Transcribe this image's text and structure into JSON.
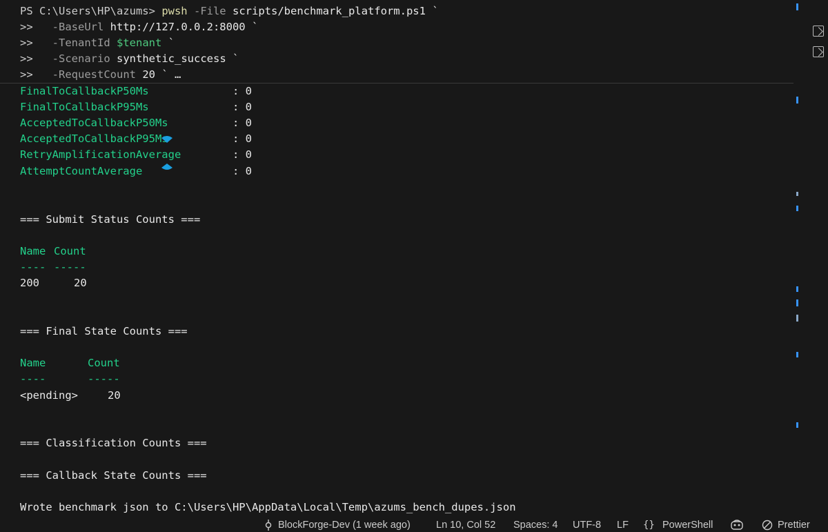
{
  "command": {
    "prompt": "PS C:\\Users\\HP\\azums>",
    "exe": "pwsh",
    "file_flag": "-File",
    "file_value": "scripts/benchmark_platform.ps1",
    "tick": "`",
    "continuation": ">>",
    "base_url_flag": "-BaseUrl",
    "base_url_value": "http://127.0.0.2:8000",
    "tenant_flag": "-TenantId",
    "tenant_value": "$tenant",
    "scenario_flag": "-Scenario",
    "scenario_value": "synthetic_success",
    "request_flag": "-RequestCount",
    "request_value": "20",
    "truncation": "` …"
  },
  "metrics": [
    {
      "name": "FinalToCallbackP50Ms",
      "value": ": 0"
    },
    {
      "name": "FinalToCallbackP95Ms",
      "value": ": 0"
    },
    {
      "name": "AcceptedToCallbackP50Ms",
      "value": ": 0"
    },
    {
      "name": "AcceptedToCallbackP95Ms",
      "value": ": 0"
    },
    {
      "name": "RetryAmplificationAverage",
      "value": ": 0"
    },
    {
      "name": "AttemptCountAverage",
      "value": ": 0"
    }
  ],
  "submit_status": {
    "heading": "=== Submit Status Counts ===",
    "col_name": "Name",
    "col_count": "Count",
    "rule_name": "----",
    "rule_count": "-----",
    "rows": [
      {
        "name": "200",
        "count": "20"
      }
    ]
  },
  "final_state": {
    "heading": "=== Final State Counts ===",
    "col_name": "Name",
    "col_count": "Count",
    "rule_name": "----",
    "rule_count": "-----",
    "rows": [
      {
        "name": "<pending>",
        "count": "20"
      }
    ]
  },
  "classification_heading": "=== Classification Counts ===",
  "callback_heading": "=== Callback State Counts ===",
  "wrote_line": "Wrote benchmark json to C:\\Users\\HP\\AppData\\Local\\Temp\\azums_bench_dupes.json",
  "status_bar": {
    "branch": "BlockForge-Dev (1 week ago)",
    "position": "Ln 10, Col 52",
    "spaces": "Spaces: 4",
    "encoding": "UTF-8",
    "eol": "LF",
    "language": "PowerShell",
    "formatter": "Prettier"
  },
  "colors": {
    "background": "#181818",
    "green_output": "#23d18b",
    "pwsh_yellow": "#dcdcaa",
    "variable_green": "#4ec97f",
    "accent_blue": "#3794ff"
  }
}
